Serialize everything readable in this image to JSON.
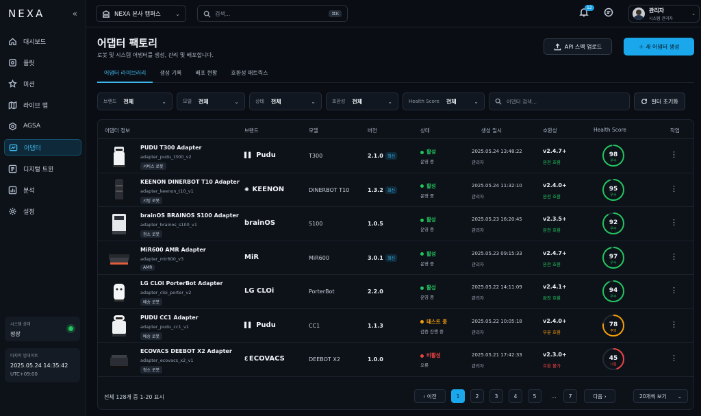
{
  "sidebar": {
    "brand": "NEXA",
    "collapse": "«",
    "items": [
      {
        "label": "대시보드",
        "icon": "home-icon"
      },
      {
        "label": "플릿",
        "icon": "fleet-icon"
      },
      {
        "label": "미션",
        "icon": "mission-icon"
      },
      {
        "label": "라이브 맵",
        "icon": "map-icon"
      },
      {
        "label": "AGSA",
        "icon": "agsa-icon"
      },
      {
        "label": "어댑터",
        "icon": "adapter-icon"
      },
      {
        "label": "디지털 트윈",
        "icon": "twin-icon"
      },
      {
        "label": "분석",
        "icon": "chart-icon"
      },
      {
        "label": "설정",
        "icon": "gear-icon"
      }
    ],
    "system_status_label": "시스템 상태",
    "system_status_value": "정상",
    "last_update_label": "마지막 업데이트",
    "last_update_value": "2025.05.24 14:35:42",
    "timezone": "UTC+09:00"
  },
  "topbar": {
    "campus": "NEXA 본사 캠퍼스",
    "search_placeholder": "검색...",
    "search_shortcut": "⌘K",
    "notif_count": "12",
    "user_name": "관리자",
    "user_role": "시스템 관리자"
  },
  "page": {
    "title": "어댑터 팩토리",
    "subtitle": "로봇 및 시스템 어댑터를 생성, 관리 및 배포합니다.",
    "upload_label": "API 스펙 업로드",
    "new_label": "＋ 새 어댑터 생성"
  },
  "tabs": [
    "어댑터 라이브러리",
    "생성 기록",
    "배포 현황",
    "호환성 매트릭스"
  ],
  "filters": {
    "brand_label": "브랜드",
    "brand_value": "전체",
    "model_label": "모델",
    "model_value": "전체",
    "status_label": "상태",
    "status_value": "전체",
    "compat_label": "호환성",
    "compat_value": "전체",
    "health_label": "Health Score",
    "health_value": "전체",
    "search_placeholder": "어댑터 검색...",
    "reset_label": "필터 초기화"
  },
  "columns": [
    "어댑터 정보",
    "브랜드",
    "모델",
    "버전",
    "상태",
    "생성 일시",
    "호환성",
    "Health Score",
    "작업"
  ],
  "rows": [
    {
      "name": "PUDU T300 Adapter",
      "id": "adapter_pudu_t300_v2",
      "tag": "서비스 로봇",
      "brand": "Pudu",
      "model": "T300",
      "version": "2.1.0",
      "latest": "최신",
      "status": "활성",
      "status_sub": "운영 중",
      "status_color": "#22c55e",
      "date": "2025.05.24 13:48:22",
      "by": "관리자",
      "compat_ver": "v2.4.7+",
      "compat": "완전 호환",
      "compat_color": "#22c55e",
      "score": 98,
      "score_label": "우수",
      "score_color": "#22c55e"
    },
    {
      "name": "KEENON DINERBOT T10 Adapter",
      "id": "adapter_keenon_t10_v1",
      "tag": "서빙 로봇",
      "brand": "KEENON",
      "model": "DINERBOT T10",
      "version": "1.3.2",
      "latest": "최신",
      "status": "활성",
      "status_sub": "운영 중",
      "status_color": "#22c55e",
      "date": "2025.05.24 11:32:10",
      "by": "관리자",
      "compat_ver": "v2.4.0+",
      "compat": "완전 호환",
      "compat_color": "#22c55e",
      "score": 95,
      "score_label": "우수",
      "score_color": "#22c55e"
    },
    {
      "name": "brainOS BRAINOS S100 Adapter",
      "id": "adapter_brainos_s100_v1",
      "tag": "청소 로봇",
      "brand": "brainOS",
      "model": "S100",
      "version": "1.0.5",
      "latest": "",
      "status": "활성",
      "status_sub": "운영 중",
      "status_color": "#22c55e",
      "date": "2025.05.23 16:20:45",
      "by": "관리자",
      "compat_ver": "v2.3.5+",
      "compat": "완전 호환",
      "compat_color": "#22c55e",
      "score": 92,
      "score_label": "우수",
      "score_color": "#22c55e"
    },
    {
      "name": "MiR600 AMR Adapter",
      "id": "adapter_mir600_v3",
      "tag": "AMR",
      "brand": "MiR",
      "model": "MiR600",
      "version": "3.0.1",
      "latest": "최신",
      "status": "활성",
      "status_sub": "운영 중",
      "status_color": "#22c55e",
      "date": "2025.05.23 09:15:33",
      "by": "관리자",
      "compat_ver": "v2.4.7+",
      "compat": "완전 호환",
      "compat_color": "#22c55e",
      "score": 97,
      "score_label": "우수",
      "score_color": "#22c55e"
    },
    {
      "name": "LG CLOi PorterBot Adapter",
      "id": "adapter_cloi_porter_v2",
      "tag": "배송 로봇",
      "brand": "LG CLOi",
      "model": "PorterBot",
      "version": "2.2.0",
      "latest": "",
      "status": "활성",
      "status_sub": "운영 중",
      "status_color": "#22c55e",
      "date": "2025.05.22 14:11:09",
      "by": "관리자",
      "compat_ver": "v2.4.1+",
      "compat": "완전 호환",
      "compat_color": "#22c55e",
      "score": 94,
      "score_label": "우수",
      "score_color": "#22c55e"
    },
    {
      "name": "PUDU CC1 Adapter",
      "id": "adapter_pudu_cc1_v1",
      "tag": "배송 로봇",
      "brand": "Pudu",
      "model": "CC1",
      "version": "1.1.3",
      "latest": "",
      "status": "테스트 중",
      "status_sub": "검증 진행 중",
      "status_color": "#f59e0b",
      "date": "2025.05.22 10:05:18",
      "by": "관리자",
      "compat_ver": "v2.4.0+",
      "compat": "부분 호환",
      "compat_color": "#f59e0b",
      "score": 78,
      "score_label": "주의",
      "score_color": "#f59e0b"
    },
    {
      "name": "ECOVACS DEEBOT X2 Adapter",
      "id": "adapter_ecovacs_x2_v1",
      "tag": "청소 로봇",
      "brand": "ECOVACS",
      "model": "DEEBOT X2",
      "version": "1.0.0",
      "latest": "",
      "status": "비활성",
      "status_sub": "오류",
      "status_color": "#ef4444",
      "date": "2025.05.21 17:42:33",
      "by": "관리자",
      "compat_ver": "v2.3.0+",
      "compat": "호환 불가",
      "compat_color": "#ef4444",
      "score": 45,
      "score_label": "나쁨",
      "score_color": "#ef4444"
    }
  ],
  "pagination": {
    "total": "전체 128개 중 1-20 표시",
    "prev": "‹  이전",
    "next": "다음  ›",
    "pages": [
      "1",
      "2",
      "3",
      "4",
      "5",
      "...",
      "7"
    ],
    "page_size": "20개씩 보기"
  }
}
